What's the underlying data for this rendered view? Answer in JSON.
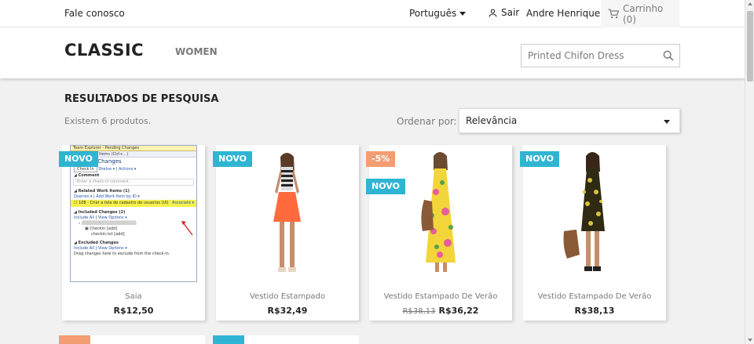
{
  "topbar": {
    "contact": "Fale conosco",
    "language": "Português",
    "signout": "Sair",
    "user": "Andre Henrique",
    "cart": "Carrinho (0)"
  },
  "header": {
    "logo": "CLASSIC",
    "menu_women": "WOMEN",
    "search_value": "Printed Chifon Dress"
  },
  "results": {
    "title": "RESULTADOS DE PESQUISA",
    "count": "Existem 6 produtos.",
    "sort_label": "Ordenar por:",
    "sort_value": "Relevância"
  },
  "products": [
    {
      "name": "Saia",
      "price": "R$12,50",
      "old_price": "",
      "badges": [
        "NOVO"
      ]
    },
    {
      "name": "Vestido Estampado",
      "price": "R$32,49",
      "old_price": "",
      "badges": [
        "NOVO"
      ]
    },
    {
      "name": "Vestido Estampado De Verão",
      "price": "R$36,22",
      "old_price": "R$38,13",
      "badges": [
        "-5%",
        "NOVO"
      ]
    },
    {
      "name": "Vestido Estampado De Verão",
      "price": "R$38,13",
      "old_price": "",
      "badges": [
        "NOVO"
      ]
    }
  ],
  "screenshot_text": {
    "title": "Team Explorer - Pending Changes",
    "search": "Search Work Items (Ctrl+...)",
    "pending": "Pending Changes",
    "checkin": "Check In",
    "shelve": "Shelve ▾",
    "actions": "Actions ▾",
    "comment": "◢ Comment",
    "comment_placeholder": "Enter a check-in comment",
    "related": "◢ Related Work Items (1)",
    "queries": "Queries ▾",
    "add_by_id": "Add Work Item by ID ▾",
    "work_item": "☐ 108 - Criar a tela de cadastro de usuarios (UI)",
    "associate": "Associate ▾",
    "included": "◢ Included Changes (2)",
    "include_all": "Include All",
    "view_options": "View Options ▾",
    "checkin_item": "▣ Checkin [add]",
    "checkin_file": "checkin.txt [add]",
    "excluded": "◢ Excluded Changes",
    "include_all_2": "Include All",
    "view_options_2": "View Options ▾",
    "drag_hint": "Drag changes here to exclude from the check-in."
  },
  "colors": {
    "badge_new": "#2fb5d2",
    "badge_discount": "#f39d72"
  }
}
